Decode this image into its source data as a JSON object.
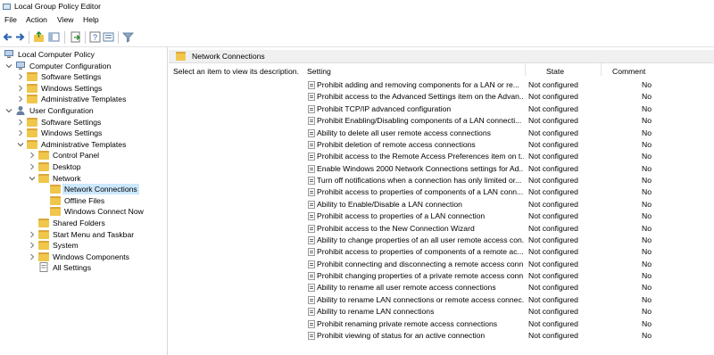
{
  "window": {
    "title": "Local Group Policy Editor"
  },
  "menu": [
    "File",
    "Action",
    "View",
    "Help"
  ],
  "toolbar": [
    "back-icon",
    "forward-icon",
    "up-folder-icon",
    "show-hide-tree-icon",
    "export-list-icon",
    "help-icon",
    "properties-icon",
    "filter-icon"
  ],
  "tree": {
    "items": [
      {
        "label": "Local Computer Policy",
        "indent": 0,
        "icon": "computer-policy-icon",
        "expander": ""
      },
      {
        "label": "Computer Configuration",
        "indent": 1,
        "icon": "computer-icon",
        "expander": "open"
      },
      {
        "label": "Software Settings",
        "indent": 2,
        "icon": "folder-icon",
        "expander": "closed"
      },
      {
        "label": "Windows Settings",
        "indent": 2,
        "icon": "folder-icon",
        "expander": "closed"
      },
      {
        "label": "Administrative Templates",
        "indent": 2,
        "icon": "folder-icon",
        "expander": "closed"
      },
      {
        "label": "User Configuration",
        "indent": 1,
        "icon": "user-icon",
        "expander": "open"
      },
      {
        "label": "Software Settings",
        "indent": 2,
        "icon": "folder-icon",
        "expander": "closed"
      },
      {
        "label": "Windows Settings",
        "indent": 2,
        "icon": "folder-icon",
        "expander": "closed"
      },
      {
        "label": "Administrative Templates",
        "indent": 2,
        "icon": "folder-icon",
        "expander": "open"
      },
      {
        "label": "Control Panel",
        "indent": 3,
        "icon": "folder-icon",
        "expander": "closed"
      },
      {
        "label": "Desktop",
        "indent": 3,
        "icon": "folder-icon",
        "expander": "closed"
      },
      {
        "label": "Network",
        "indent": 3,
        "icon": "folder-icon",
        "expander": "open"
      },
      {
        "label": "Network Connections",
        "indent": 4,
        "icon": "folder-open-icon",
        "expander": "",
        "selected": true
      },
      {
        "label": "Offline Files",
        "indent": 4,
        "icon": "folder-icon",
        "expander": ""
      },
      {
        "label": "Windows Connect Now",
        "indent": 4,
        "icon": "folder-icon",
        "expander": ""
      },
      {
        "label": "Shared Folders",
        "indent": 3,
        "icon": "folder-icon",
        "expander": ""
      },
      {
        "label": "Start Menu and Taskbar",
        "indent": 3,
        "icon": "folder-icon",
        "expander": "closed"
      },
      {
        "label": "System",
        "indent": 3,
        "icon": "folder-icon",
        "expander": "closed"
      },
      {
        "label": "Windows Components",
        "indent": 3,
        "icon": "folder-icon",
        "expander": "closed"
      },
      {
        "label": "All Settings",
        "indent": 3,
        "icon": "all-settings-icon",
        "expander": ""
      }
    ]
  },
  "main": {
    "header": "Network Connections",
    "description": "Select an item to view its description.",
    "columns": {
      "setting": "Setting",
      "state": "State",
      "comment": "Comment"
    },
    "rows": [
      {
        "setting": "Prohibit adding and removing components for a LAN or re...",
        "state": "Not configured",
        "comment": "No"
      },
      {
        "setting": "Prohibit access to the Advanced Settings item on the Advan...",
        "state": "Not configured",
        "comment": "No"
      },
      {
        "setting": "Prohibit TCP/IP advanced configuration",
        "state": "Not configured",
        "comment": "No"
      },
      {
        "setting": "Prohibit Enabling/Disabling components of a LAN connecti...",
        "state": "Not configured",
        "comment": "No"
      },
      {
        "setting": "Ability to delete all user remote access connections",
        "state": "Not configured",
        "comment": "No"
      },
      {
        "setting": "Prohibit deletion of remote access connections",
        "state": "Not configured",
        "comment": "No"
      },
      {
        "setting": "Prohibit access to the Remote Access Preferences item on t...",
        "state": "Not configured",
        "comment": "No"
      },
      {
        "setting": "Enable Windows 2000 Network Connections settings for Ad...",
        "state": "Not configured",
        "comment": "No"
      },
      {
        "setting": "Turn off notifications when a connection has only limited or...",
        "state": "Not configured",
        "comment": "No"
      },
      {
        "setting": "Prohibit access to properties of components of a LAN conn...",
        "state": "Not configured",
        "comment": "No"
      },
      {
        "setting": "Ability to Enable/Disable a LAN connection",
        "state": "Not configured",
        "comment": "No"
      },
      {
        "setting": "Prohibit access to properties of a LAN connection",
        "state": "Not configured",
        "comment": "No"
      },
      {
        "setting": "Prohibit access to the New Connection Wizard",
        "state": "Not configured",
        "comment": "No"
      },
      {
        "setting": "Ability to change properties of an all user remote access con...",
        "state": "Not configured",
        "comment": "No"
      },
      {
        "setting": "Prohibit access to properties of components of a remote ac...",
        "state": "Not configured",
        "comment": "No"
      },
      {
        "setting": "Prohibit connecting and disconnecting a remote access conn...",
        "state": "Not configured",
        "comment": "No"
      },
      {
        "setting": "Prohibit changing properties of a private remote access conn...",
        "state": "Not configured",
        "comment": "No"
      },
      {
        "setting": "Ability to rename all user remote access connections",
        "state": "Not configured",
        "comment": "No"
      },
      {
        "setting": "Ability to rename LAN connections or remote access connec...",
        "state": "Not configured",
        "comment": "No"
      },
      {
        "setting": "Ability to rename LAN connections",
        "state": "Not configured",
        "comment": "No"
      },
      {
        "setting": "Prohibit renaming private remote access connections",
        "state": "Not configured",
        "comment": "No"
      },
      {
        "setting": "Prohibit viewing of status for an active connection",
        "state": "Not configured",
        "comment": "No"
      }
    ]
  },
  "colors": {
    "selection": "#cce8ff",
    "folder": "#f0c64b",
    "header_bg": "#f0f0f0"
  }
}
